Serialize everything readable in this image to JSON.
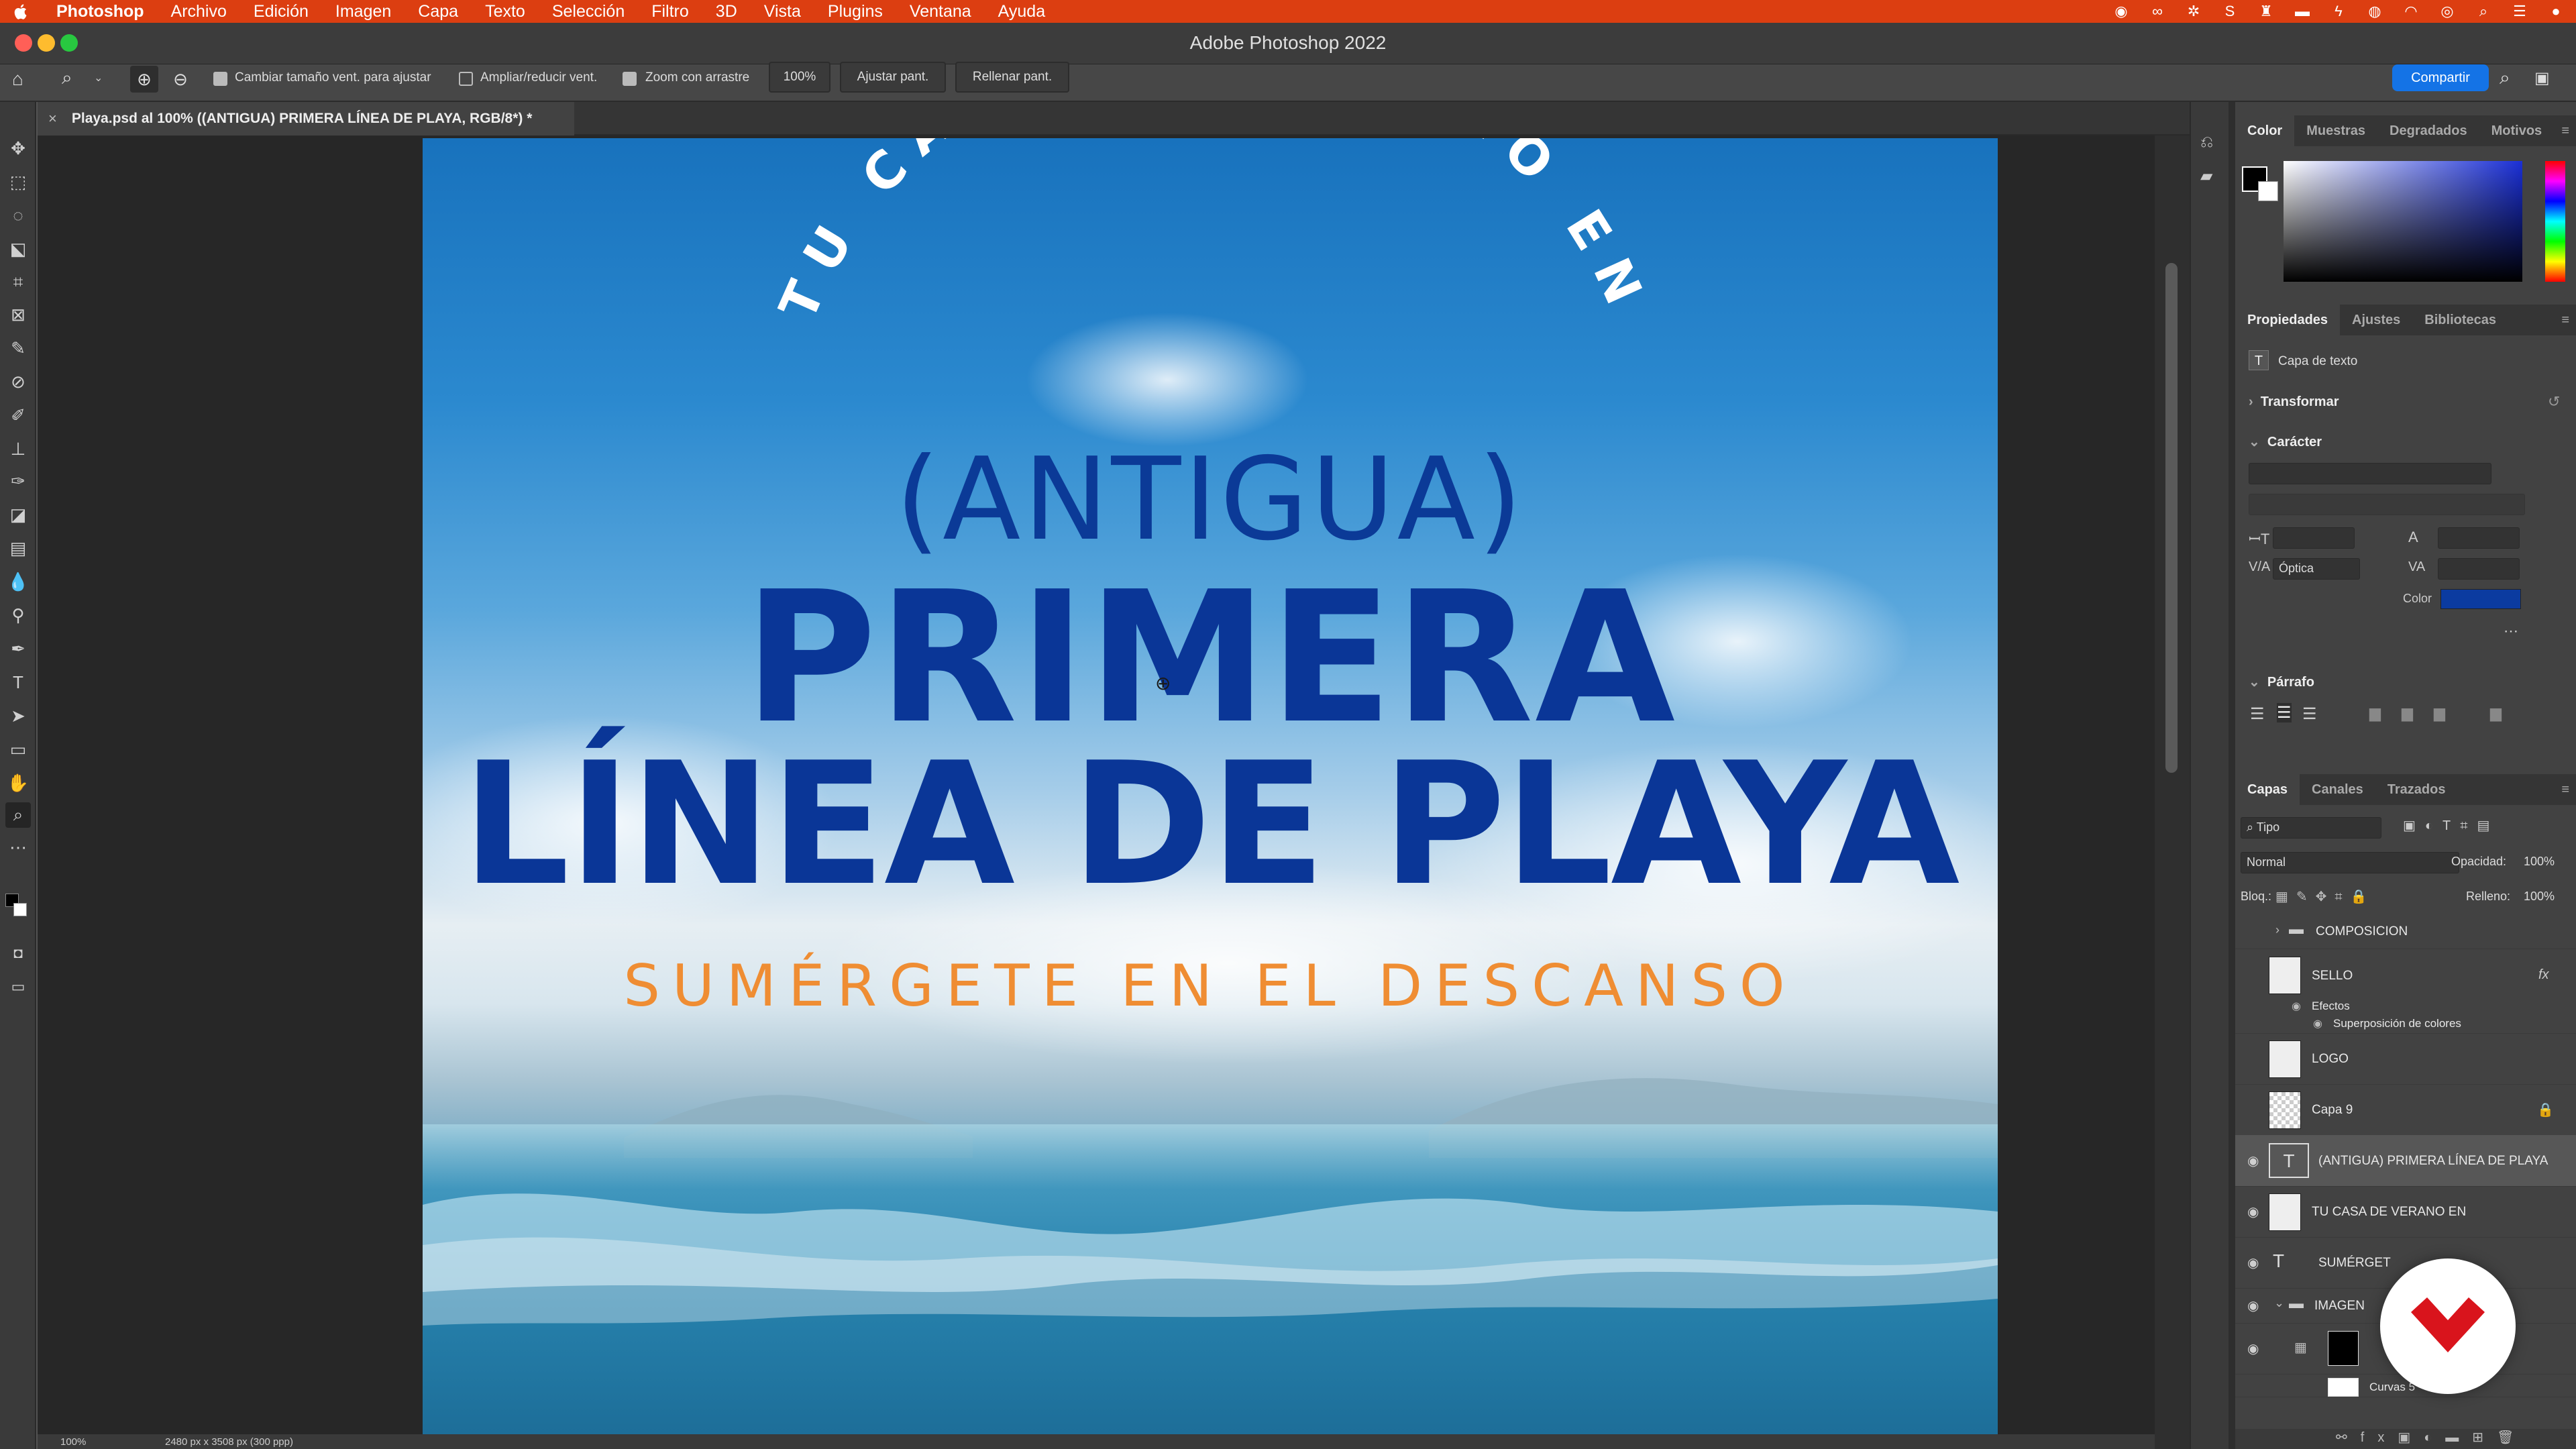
{
  "menubar": {
    "app": "Photoshop",
    "items": [
      "Archivo",
      "Edición",
      "Imagen",
      "Capa",
      "Texto",
      "Selección",
      "Filtro",
      "3D",
      "Vista",
      "Plugins",
      "Ventana",
      "Ayuda"
    ]
  },
  "window": {
    "title": "Adobe Photoshop 2022"
  },
  "options": {
    "check1": "Cambiar tamaño vent. para ajustar",
    "check2": "Ampliar/reducir vent.",
    "check3": "Zoom con arrastre",
    "zoom_value": "100%",
    "fit_button": "Ajustar pant.",
    "fill_button": "Rellenar pant.",
    "share_button": "Compartir"
  },
  "document": {
    "tab": "Playa.psd al 100% ((ANTIGUA) PRIMERA LÍNEA DE PLAYA, RGB/8*) *"
  },
  "artwork": {
    "arc_text": "TU CASA DE VERANO EN",
    "line_antigua": "(ANTIGUA)",
    "line_primera": "PRIMERA",
    "line_linea": "LÍNEA DE PLAYA",
    "line_sumergete": "SUMÉRGETE EN EL DESCANSO",
    "colors": {
      "headline": "#0a3697",
      "tagline": "#ef8d33",
      "arc": "#ffffff"
    }
  },
  "color_panel": {
    "tabs": [
      "Color",
      "Muestras",
      "Degradados",
      "Motivos"
    ],
    "active": "Color"
  },
  "properties": {
    "tabs": [
      "Propiedades",
      "Ajustes",
      "Bibliotecas"
    ],
    "layer_kind": "Capa de texto",
    "transform": "Transformar",
    "character": "Carácter",
    "kerning": "Óptica",
    "color_label": "Color",
    "text_color": "#0b3ba0",
    "paragraph": "Párrafo"
  },
  "layers": {
    "tabs": [
      "Capas",
      "Canales",
      "Trazados"
    ],
    "filter": "Tipo",
    "blend": "Normal",
    "opacity_label": "Opacidad:",
    "opacity": "100%",
    "lock_label": "Bloq.:",
    "fill_label": "Relleno:",
    "fill": "100%",
    "composicion": "COMPOSICION",
    "sello": "SELLO",
    "efectos": "Efectos",
    "superposicion": "Superposición de colores",
    "logo": "LOGO",
    "capa9": "Capa 9",
    "antigua_layer": "(ANTIGUA) PRIMERA LÍNEA DE PLAYA",
    "tu_casa": "TU CASA DE VERANO EN",
    "sumergete": "SUMÉRGET",
    "imagen": "IMAGEN",
    "curvas": "Curvas 5"
  },
  "statusbar": {
    "zoom": "100%",
    "dims": "2480 px x 3508 px (300 ppp)"
  }
}
